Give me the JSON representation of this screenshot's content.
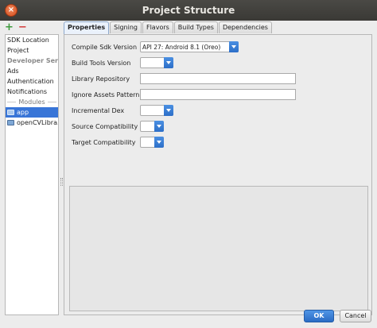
{
  "window": {
    "title": "Project Structure"
  },
  "toolbar": {
    "add_symbol": "+",
    "remove_symbol": "−"
  },
  "sidebar": {
    "items": [
      {
        "label": "SDK Location"
      },
      {
        "label": "Project"
      },
      {
        "label": "Developer Serv..."
      },
      {
        "label": "Ads"
      },
      {
        "label": "Authentication"
      },
      {
        "label": "Notifications"
      }
    ],
    "modules_header": "Modules",
    "modules": [
      {
        "label": "app"
      },
      {
        "label": "openCVLibra..."
      }
    ]
  },
  "tabs": [
    {
      "label": "Properties"
    },
    {
      "label": "Signing"
    },
    {
      "label": "Flavors"
    },
    {
      "label": "Build Types"
    },
    {
      "label": "Dependencies"
    }
  ],
  "form": {
    "compile_sdk": {
      "label": "Compile Sdk Version",
      "value": "API 27: Android 8.1 (Oreo)"
    },
    "build_tools": {
      "label": "Build Tools Version",
      "value": ""
    },
    "library_repo": {
      "label": "Library Repository",
      "value": ""
    },
    "ignore_assets": {
      "label": "Ignore Assets Pattern",
      "value": ""
    },
    "incremental_dex": {
      "label": "Incremental Dex",
      "value": ""
    },
    "source_compat": {
      "label": "Source Compatibility",
      "value": ""
    },
    "target_compat": {
      "label": "Target Compatibility",
      "value": ""
    }
  },
  "footer": {
    "ok_label": "OK",
    "cancel_label": "Cancel"
  },
  "colors": {
    "accent": "#3875d7",
    "add": "#3d9a3d",
    "remove": "#d23b3b"
  }
}
